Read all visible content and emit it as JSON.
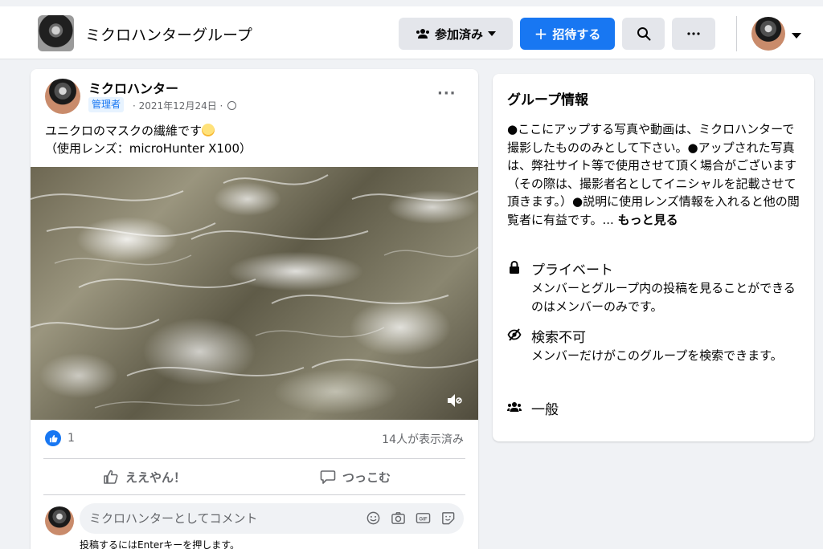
{
  "header": {
    "group_name": "ミクロハンターグループ",
    "joined_label": "参加済み",
    "invite_label": "招待する"
  },
  "post": {
    "author": "ミクロハンター",
    "role_badge": "管理者",
    "meta": "· 2021年12月24日 ·",
    "text_line1": "ユニクロのマスクの繊維です",
    "text_line2": "（使用レンズ：microHunter X100）",
    "like_count": "1",
    "views": "14人が表示済み",
    "like_action": "ええやん！",
    "comment_action": "つっこむ",
    "comment_placeholder": "ミクロハンターとしてコメント",
    "comment_hint": "投稿するにはEnterキーを押します。"
  },
  "group_info": {
    "title": "グループ情報",
    "description": "●ここにアップする写真や動画は、ミクロハンターで撮影したもののみとして下さい。●アップされた写真は、弊社サイト等で使用させて頂く場合がございます（その際は、撮影者名としてイニシャルを記載させて頂きます。）●説明に使用レンズ情報を入れると他の閲覧者に有益です。...",
    "more_link": "もっと見る",
    "privacy_label": "プライベート",
    "privacy_desc": "メンバーとグループ内の投稿を見ることができるのはメンバーのみです。",
    "search_label": "検索不可",
    "search_desc": "メンバーだけがこのグループを検索できます。",
    "general_label": "一般"
  },
  "colors": {
    "accent": "#1877f2",
    "background": "#f0f2f5",
    "secondary_text": "#65676b"
  }
}
